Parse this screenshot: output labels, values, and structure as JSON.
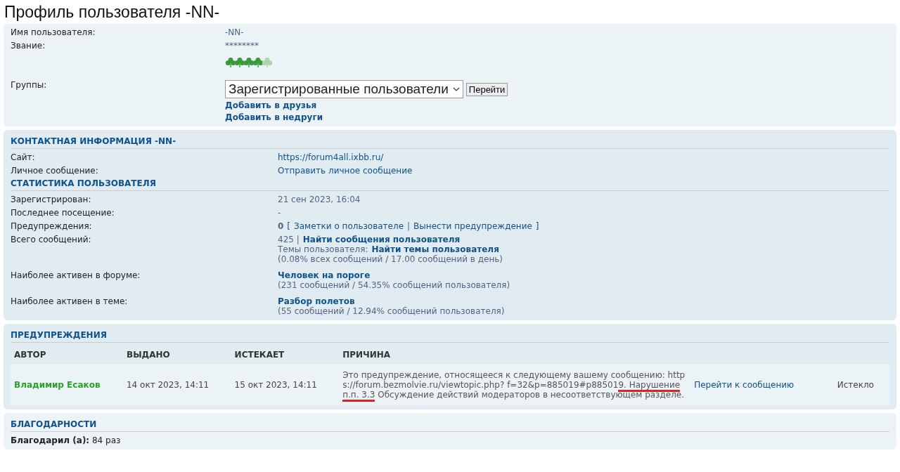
{
  "title": "Профиль пользователя -NN-",
  "profile": {
    "rows": [
      {
        "label": "Имя пользователя:",
        "value": "-NN-"
      },
      {
        "label": "Звание:",
        "value": "********"
      }
    ],
    "rank_stars": {
      "stars": 4
    },
    "groups": {
      "label": "Группы:",
      "selected_value": "Зарегистрированные пользователи",
      "button": "Перейти"
    },
    "links": [
      "Добавить в друзья",
      "Добавить в недруги"
    ]
  },
  "contact": {
    "heading": "КОНТАКТНАЯ ИНФОРМАЦИЯ -NN-",
    "rows": [
      {
        "label": "Сайт:",
        "value": "https://forum4all.ixbb.ru/"
      },
      {
        "label": "Личное сообщение:",
        "value": "Отправить личное сообщение"
      }
    ]
  },
  "stats": {
    "heading": "СТАТИСТИКА ПОЛЬЗОВАТЕЛЯ",
    "registered": {
      "label": "Зарегистрирован:",
      "value": "21 сен 2023, 16:04"
    },
    "last_visit": {
      "label": "Последнее посещение:",
      "value": "-"
    },
    "warnings": {
      "label": "Предупреждения:",
      "count": "0",
      "open": "[",
      "links": [
        "Заметки о пользователе",
        "Вынести предупреждение"
      ],
      "separator": "|",
      "close": "]"
    },
    "posts": {
      "label": "Всего сообщений:",
      "count": "425 |",
      "link": "Найти сообщения пользователя",
      "topics_label": "Темы пользователя:",
      "topics_link": "Найти темы пользователя",
      "note": "(0.08% всех сообщений / 17.00 сообщений в день)"
    },
    "active": [
      {
        "label": "Наиболее активен в форуме:",
        "link": "Человек на пороге",
        "note": "(231 сообщений / 54.35% сообщений пользователя)"
      },
      {
        "label": "Наиболее активен в теме:",
        "link": "Разбор полетов",
        "note": "(55 сообщений / 12.94% сообщений пользователя)"
      }
    ]
  },
  "warnings_table": {
    "heading": "ПРЕДУПРЕЖДЕНИЯ",
    "columns": [
      "АВТОР",
      "ВЫДАНО",
      "ИСТЕКАЕТ",
      "ПРИЧИНА"
    ],
    "rows": [
      {
        "author": "Владимир Есаков",
        "issued": "14 окт 2023, 14:11",
        "expires": "15 окт 2023, 14:11",
        "reason": [
          {
            "text": "Это предупреждение, относящееся к следующему вашему сообщению: https://forum.bezmolvie.ru/viewtopic.php? f=32&p=885019#p88501",
            "underlined": false
          },
          {
            "text": "9. Нарушение п.п. 3.3",
            "underlined": true
          },
          {
            "text": " Обсуждение действий модераторов в несоответствующем разделе.",
            "underlined": false
          }
        ],
        "link": "Перейти к сообщению",
        "status": "Истекло"
      }
    ]
  },
  "thanks": {
    "heading": "БЛАГОДАРНОСТИ",
    "label": "Благодарил (а):",
    "value": "84 раз"
  }
}
